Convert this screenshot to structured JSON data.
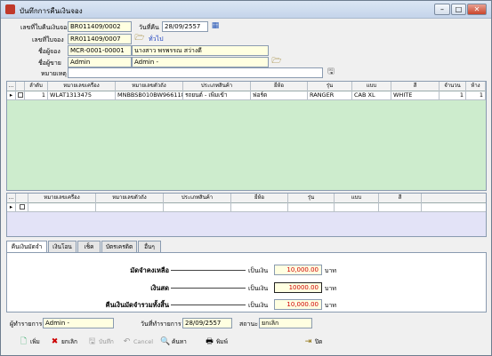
{
  "window": {
    "title": "บันทึกการคืนเงินจอง",
    "min": "–",
    "max": "□",
    "close": "✕"
  },
  "header": {
    "voucher_label": "เลขที่ใบคืนเงินจอง",
    "voucher_value": "BR011409/0002",
    "date_label": "วันที่คืน",
    "date_value": "28/09/2557",
    "booking_label": "เลขที่ใบจอง",
    "booking_value": "RR011409/0007",
    "general_link": "ทั่วไป",
    "customer_label": "ชื่อผู้จอง",
    "customer_code": "MCR-0001-00001",
    "customer_name": "นางสาว พรพรรณ สว่างดี",
    "salesperson_label": "ชื่อผู้ขาย",
    "salesperson_code": "Admin",
    "salesperson_name": "Admin -",
    "note_label": "หมายเหตุ",
    "note_value": ""
  },
  "grid1": {
    "columns": [
      "...",
      "ลำดับ",
      "หมายเลขเครื่อง",
      "หมายเลขตัวถัง",
      "ประเภทสินค้า",
      "ยี่ห้อ",
      "รุ่น",
      "แบบ",
      "สี",
      "จำนวน",
      "ห้าง"
    ],
    "rows": [
      [
        "",
        "1",
        "WLAT1313475",
        "MNBBSB010BW966118",
        "รถยนต์ - เพิ่มเข้า",
        "ฟอร์ด",
        "RANGER",
        "CAB XL",
        "WHITE",
        "1",
        "1"
      ]
    ]
  },
  "grid2": {
    "columns": [
      "...",
      "หมายเลขเครื่อง",
      "หมายเลขตัวถัง",
      "ประเภทสินค้า",
      "ยี่ห้อ",
      "รุ่น",
      "แบบ",
      "สี"
    ]
  },
  "tabs": [
    "คืนเงินมัดจำ",
    "เงินโอน",
    "เช็ค",
    "บัตรเครดิต",
    "อื่นๆ"
  ],
  "summary": {
    "remaining_label": "มัดจำคงเหลือ",
    "remaining_value": "10,000.00",
    "cash_label": "เงินสด",
    "cash_value": "10000.00",
    "refund_label": "คืนเงินมัดจำรวมทั้งสิ้น",
    "refund_value": "10,000.00",
    "unit_prefix": "เป็นเงิน",
    "unit_suffix": "บาท"
  },
  "footer": {
    "maker_label": "ผู้ทำรายการ",
    "maker_value": "Admin -",
    "made_date_label": "วันที่ทำรายการ",
    "made_date_value": "28/09/2557",
    "status_label": "สถานะ",
    "status_value": "ยกเลิก"
  },
  "toolbar": {
    "add": "เพิ่ม",
    "cancel_doc": "ยกเลิก",
    "save": "บันทึก",
    "cancel": "Cancel",
    "search": "ค้นหา",
    "print": "พิมพ์",
    "close": "ปิด"
  },
  "colors": {
    "accent_red": "#d00000",
    "grid_bg": "#cdeccd",
    "grid2_bg": "#e3e3f7"
  }
}
